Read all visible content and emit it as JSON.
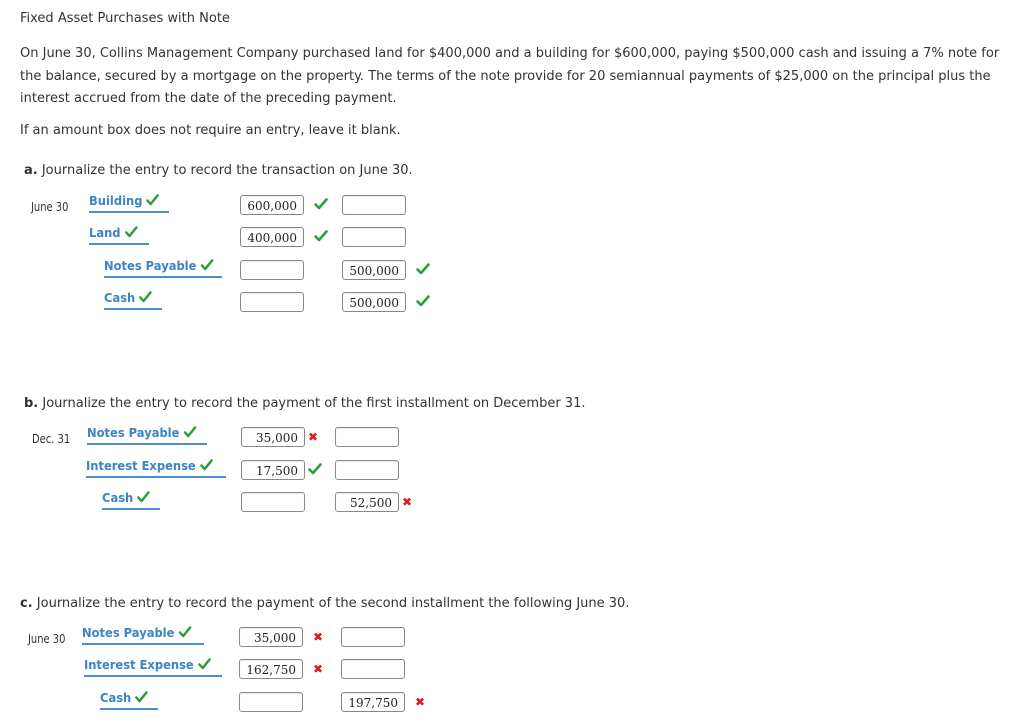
{
  "title": "Fixed Asset Purchases with Note",
  "problem_text": "On June 30, Collins Management Company purchased land for $400,000 and a building for $600,000, paying $500,000 cash and issuing a 7% note for the balance, secured by a mortgage on the property. The terms of the note provide for 20 semiannual payments of $25,000 on the principal plus the interest accrued from the date of the preceding payment.",
  "instruction": "If an amount box does not require an entry, leave it blank.",
  "colors": {
    "account_blue": "#3d84c4",
    "check_green": "#2e9e3a",
    "x_red": "#e01b1b"
  },
  "parts": [
    {
      "letter": "a.",
      "prompt": "Journalize the entry to record the transaction on June 30.",
      "date": "June 30",
      "rows": [
        {
          "account": "Building",
          "account_mark": "check",
          "debit": "600,000",
          "debit_mark": "check",
          "credit": "",
          "credit_mark": ""
        },
        {
          "account": "Land",
          "account_mark": "check",
          "debit": "400,000",
          "debit_mark": "check",
          "credit": "",
          "credit_mark": ""
        },
        {
          "account": "Notes Payable",
          "account_mark": "check",
          "debit": "",
          "debit_mark": "",
          "credit": "500,000",
          "credit_mark": "check"
        },
        {
          "account": "Cash",
          "account_mark": "check",
          "debit": "",
          "debit_mark": "",
          "credit": "500,000",
          "credit_mark": "check"
        }
      ]
    },
    {
      "letter": "b.",
      "prompt": "Journalize the entry to record the payment of the first installment on December 31.",
      "date": "Dec. 31",
      "rows": [
        {
          "account": "Notes Payable",
          "account_mark": "check",
          "debit": "35,000",
          "debit_mark": "x",
          "credit": "",
          "credit_mark": ""
        },
        {
          "account": "Interest Expense",
          "account_mark": "check",
          "debit": "17,500",
          "debit_mark": "check",
          "credit": "",
          "credit_mark": ""
        },
        {
          "account": "Cash",
          "account_mark": "check",
          "debit": "",
          "debit_mark": "",
          "credit": "52,500",
          "credit_mark": "x"
        }
      ]
    },
    {
      "letter": "c.",
      "prompt": "Journalize the entry to record the payment of the second installment the following June 30.",
      "date": "June 30",
      "rows": [
        {
          "account": "Notes Payable",
          "account_mark": "check",
          "debit": "35,000",
          "debit_mark": "x",
          "credit": "",
          "credit_mark": ""
        },
        {
          "account": "Interest Expense",
          "account_mark": "check",
          "debit": "162,750",
          "debit_mark": "x",
          "credit": "",
          "credit_mark": ""
        },
        {
          "account": "Cash",
          "account_mark": "check",
          "debit": "",
          "debit_mark": "",
          "credit": "197,750",
          "credit_mark": "x"
        }
      ]
    }
  ]
}
